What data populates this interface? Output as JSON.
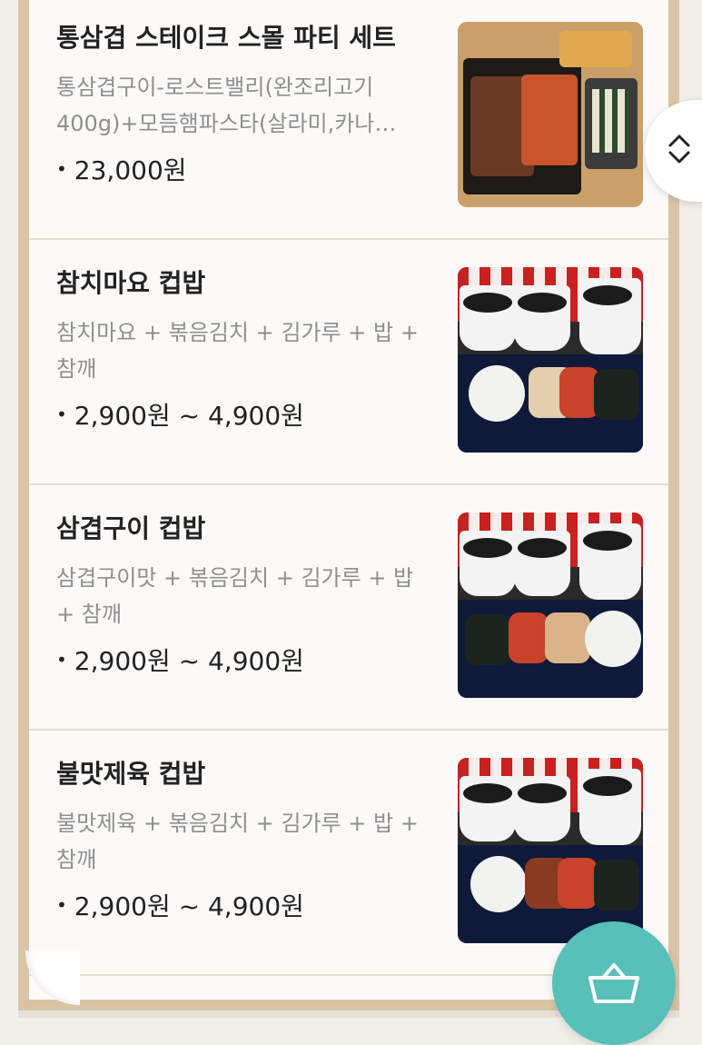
{
  "menu": {
    "items": [
      {
        "name": "통삼겹 스테이크 스몰 파티 세트",
        "desc": "통삼겹구이-로스트밸리(완조리고기400g)+모듬햄파스타(살라미,카나…",
        "price": "23,000원"
      },
      {
        "name": "참치마요 컵밥",
        "desc": "참치마요 + 볶음김치 + 김가루 + 밥 + 참깨",
        "price": "2,900원 ~ 4,900원"
      },
      {
        "name": "삼겹구이 컵밥",
        "desc": "삼겹구이맛 + 볶음김치 + 김가루 + 밥 + 참깨",
        "price": "2,900원 ~ 4,900원"
      },
      {
        "name": "불맛제육 컵밥",
        "desc": "불맛제육 + 볶음김치 + 김가루 + 밥 + 참깨",
        "price": "2,900원 ~ 4,900원"
      }
    ]
  },
  "icons": {
    "scroll": "chevron-up-down-icon",
    "cart": "shopping-basket-icon"
  },
  "colors": {
    "frame": "#d9c5a5",
    "cart_button": "#58bfb9"
  }
}
